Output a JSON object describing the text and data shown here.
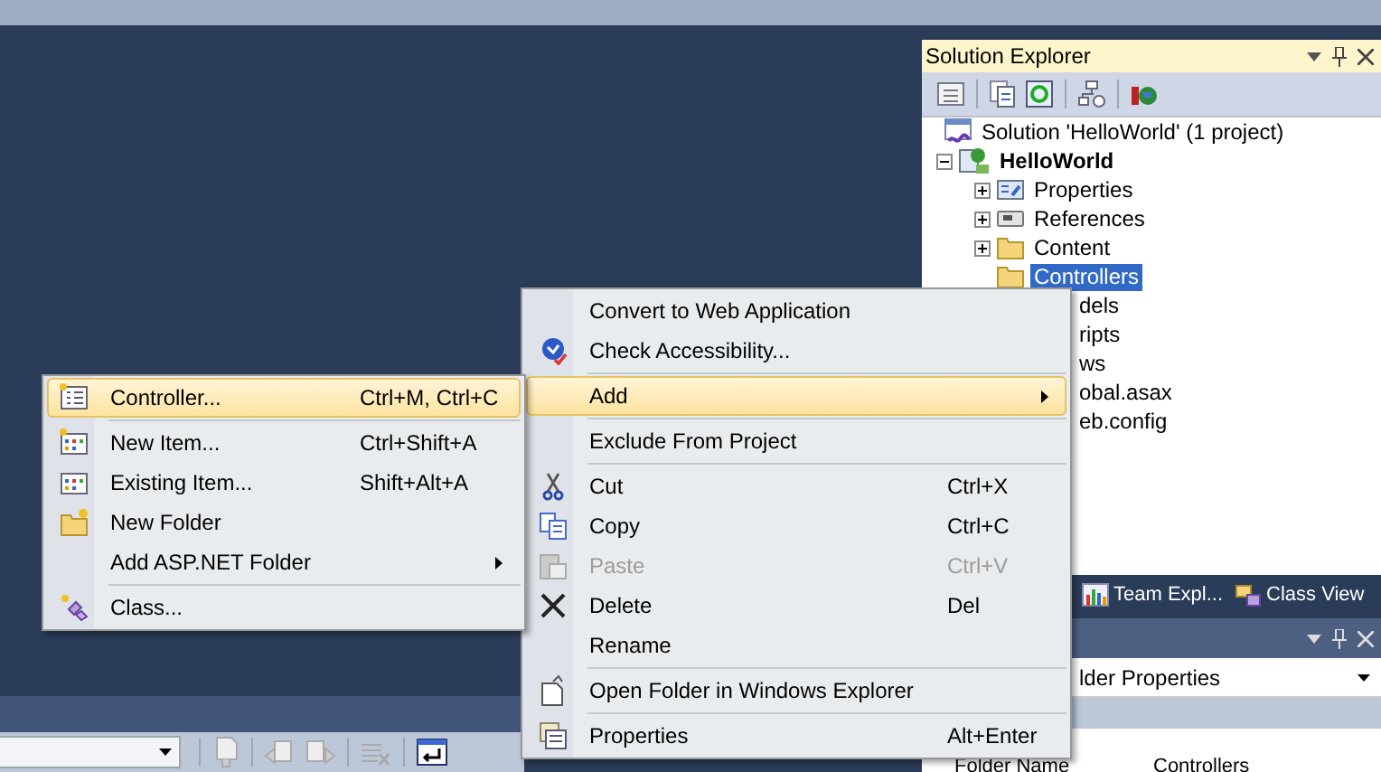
{
  "solution_explorer": {
    "title": "Solution Explorer",
    "tree": [
      {
        "label": "Solution 'HelloWorld' (1 project)",
        "bold": false,
        "selected": false,
        "children": [
          {
            "label": "HelloWorld",
            "bold": true,
            "selected": false,
            "expanded": true,
            "children": [
              {
                "label": "Properties",
                "kind": "full",
                "selected": false,
                "expanded": false
              },
              {
                "label": "References",
                "kind": "full",
                "selected": false,
                "expanded": false
              },
              {
                "label": "Content",
                "kind": "full",
                "selected": false,
                "expanded": false
              },
              {
                "label": "Controllers",
                "kind": "full",
                "selected": true
              },
              {
                "label": "dels",
                "kind": "covered",
                "selected": false
              },
              {
                "label": "ripts",
                "kind": "covered",
                "selected": false
              },
              {
                "label": "ws",
                "kind": "covered",
                "selected": false
              },
              {
                "label": "obal.asax",
                "kind": "covered",
                "selected": false
              },
              {
                "label": "eb.config",
                "kind": "covered",
                "selected": false
              }
            ]
          }
        ]
      }
    ]
  },
  "tabs": [
    {
      "label": "Team Expl...",
      "selected": false
    },
    {
      "label": "Class View",
      "selected": false
    }
  ],
  "properties": {
    "object": "lder Properties",
    "rows": [
      {
        "name": "Folder Name",
        "value": "Controllers"
      }
    ]
  },
  "context_menu": [
    {
      "kind": "item",
      "label": "Convert to Web Application",
      "highlighted": false,
      "disabled": false,
      "submenu": false
    },
    {
      "kind": "item",
      "label": "Check Accessibility...",
      "highlighted": false,
      "disabled": false,
      "submenu": false
    },
    {
      "kind": "separator"
    },
    {
      "kind": "item",
      "label": "Add",
      "highlighted": true,
      "disabled": false,
      "submenu": true
    },
    {
      "kind": "separator"
    },
    {
      "kind": "item",
      "label": "Exclude From Project",
      "highlighted": false,
      "disabled": false,
      "submenu": false
    },
    {
      "kind": "separator"
    },
    {
      "kind": "item",
      "label": "Cut",
      "shortcut": "Ctrl+X",
      "highlighted": false,
      "disabled": false,
      "submenu": false
    },
    {
      "kind": "item",
      "label": "Copy",
      "shortcut": "Ctrl+C",
      "highlighted": false,
      "disabled": false,
      "submenu": false
    },
    {
      "kind": "item",
      "label": "Paste",
      "shortcut": "Ctrl+V",
      "highlighted": false,
      "disabled": true,
      "submenu": false
    },
    {
      "kind": "item",
      "label": "Delete",
      "shortcut": "Del",
      "highlighted": false,
      "disabled": false,
      "submenu": false
    },
    {
      "kind": "item",
      "label": "Rename",
      "highlighted": false,
      "disabled": false,
      "submenu": false
    },
    {
      "kind": "separator"
    },
    {
      "kind": "item",
      "label": "Open Folder in Windows Explorer",
      "highlighted": false,
      "disabled": false,
      "submenu": false
    },
    {
      "kind": "separator"
    },
    {
      "kind": "item",
      "label": "Properties",
      "shortcut": "Alt+Enter",
      "highlighted": false,
      "disabled": false,
      "submenu": false
    }
  ],
  "add_submenu": [
    {
      "kind": "item",
      "label": "Controller...",
      "shortcut": "Ctrl+M, Ctrl+C",
      "highlighted": true,
      "disabled": false,
      "submenu": false
    },
    {
      "kind": "separator"
    },
    {
      "kind": "item",
      "label": "New Item...",
      "shortcut": "Ctrl+Shift+A",
      "highlighted": false,
      "disabled": false,
      "submenu": false
    },
    {
      "kind": "item",
      "label": "Existing Item...",
      "shortcut": "Shift+Alt+A",
      "highlighted": false,
      "disabled": false,
      "submenu": false
    },
    {
      "kind": "item",
      "label": "New Folder",
      "highlighted": false,
      "disabled": false,
      "submenu": false
    },
    {
      "kind": "item",
      "label": "Add ASP.NET Folder",
      "highlighted": false,
      "disabled": false,
      "submenu": true
    },
    {
      "kind": "separator"
    },
    {
      "kind": "item",
      "label": "Class...",
      "highlighted": false,
      "disabled": false,
      "submenu": false
    }
  ]
}
